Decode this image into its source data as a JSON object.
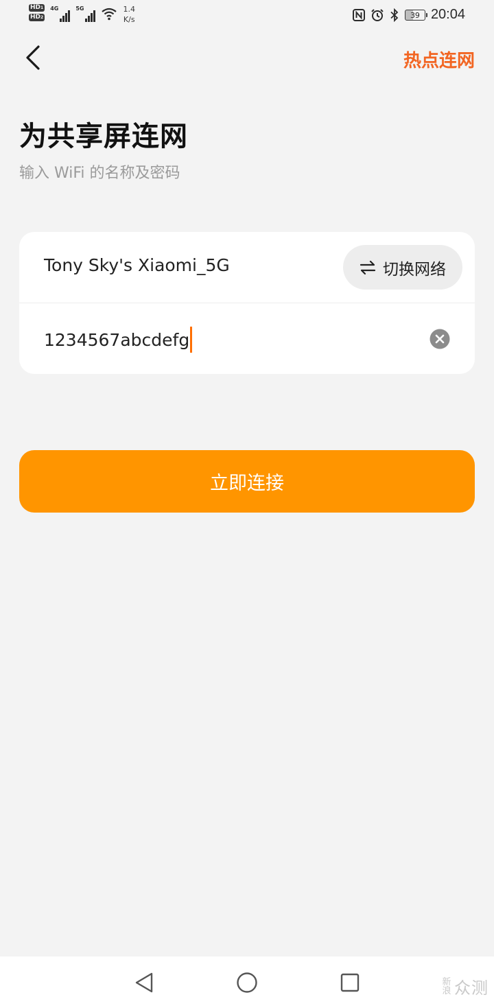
{
  "status_bar": {
    "hd1": "HD",
    "hd1_sub": "1",
    "hd2": "HD",
    "hd2_sub": "2",
    "net1": "4G",
    "net2": "5G",
    "speed_value": "1.4",
    "speed_unit": "K/s",
    "battery": "39",
    "time": "20:04",
    "icons": [
      "nfc-icon",
      "alarm-icon",
      "bluetooth-icon"
    ]
  },
  "header": {
    "back_icon": "chevron-left-icon",
    "hotspot_label": "热点连网"
  },
  "page": {
    "title": "为共享屏连网",
    "subtitle": "输入 WiFi 的名称及密码"
  },
  "form": {
    "ssid": "Tony Sky's Xiaomi_5G",
    "switch_network_label": "切换网络",
    "switch_icon": "swap-arrows-icon",
    "password": "1234567abcdefg",
    "clear_icon": "clear-circle-icon"
  },
  "connect": {
    "label": "立即连接"
  },
  "nav": {
    "back_icon": "triangle-back-icon",
    "home_icon": "circle-home-icon",
    "recent_icon": "square-recents-icon"
  },
  "watermark": {
    "small_top": "新",
    "small_bottom": "浪",
    "big": "众测"
  },
  "colors": {
    "accent": "#ff9500",
    "hotspot": "#f26522",
    "caret": "#ff6f00",
    "background": "#f3f3f3"
  }
}
